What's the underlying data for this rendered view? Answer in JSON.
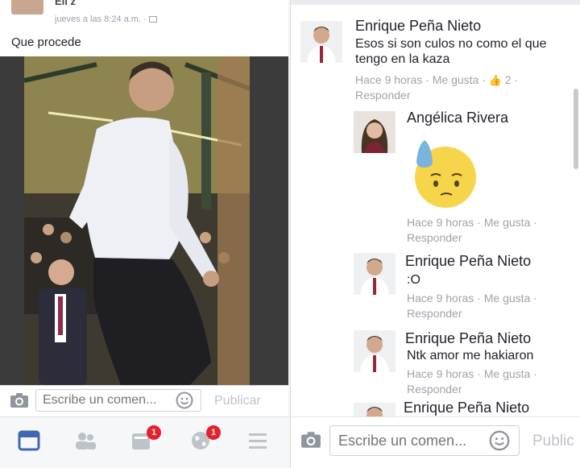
{
  "left": {
    "author": "Eli z",
    "time": "jueves a las 8:24 a.m. · ",
    "post_text": "Que procede",
    "comment_placeholder": "Escribe un comen...",
    "publish_label": "Publicar",
    "nav": {
      "groups_badge": "1",
      "notifications_badge": "1"
    }
  },
  "right": {
    "comments": [
      {
        "name": "Enrique Peña Nieto",
        "text": "Esos si son culos no como el que tengo en la kaza",
        "time": "Hace 9 horas",
        "like": "Me gusta",
        "likes_count": "2",
        "reply": "Responder"
      },
      {
        "name": "Angélica Rivera",
        "text": "",
        "time": "Hace 9 horas",
        "like": "Me gusta",
        "reply": "Responder"
      },
      {
        "name": "Enrique Peña Nieto",
        "text": ":O",
        "time": "Hace 9 horas",
        "like": "Me gusta",
        "reply": "Responder"
      },
      {
        "name": "Enrique Peña Nieto",
        "text": "Ntk amor me hakiaron",
        "time": "Hace 9 horas",
        "like": "Me gusta",
        "reply": "Responder"
      },
      {
        "name": "Enrique Peña Nieto"
      }
    ],
    "comment_placeholder": "Escribe un comen...",
    "publish_label": "Public"
  },
  "colors": {
    "link_blue": "#4267b2",
    "badge_red": "#e8202d",
    "meta_gray": "#9ea3aa"
  },
  "icons": [
    "camera-icon",
    "smiley-icon",
    "news-feed-icon",
    "friends-icon",
    "groups-icon",
    "globe-icon",
    "menu-icon",
    "like-thumb-icon",
    "sweat-emoji-icon"
  ]
}
